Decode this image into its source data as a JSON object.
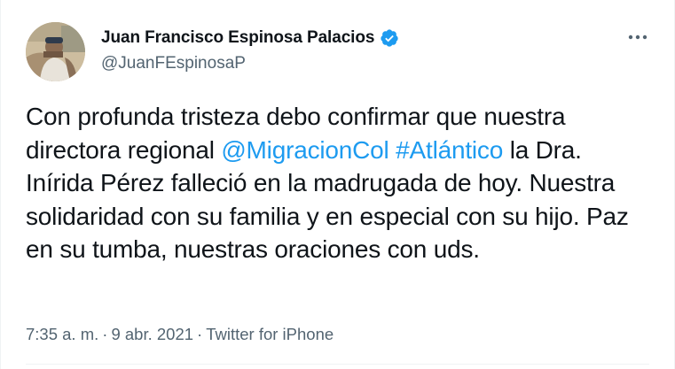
{
  "tweet": {
    "author": {
      "display_name": "Juan Francisco Espinosa Palacios",
      "handle": "@JuanFEspinosaP",
      "verified": true,
      "avatar_icon": "profile-photo"
    },
    "text": {
      "part1": "Con profunda tristeza debo confirmar que nuestra directora regional ",
      "mention": "@MigracionCol",
      "space": " ",
      "hashtag": "#Atlántico",
      "part2": " la Dra. Inírida Pérez falleció en la madrugada de hoy. Nuestra solidaridad con su familia y en especial con su hijo. Paz en su tumba, nuestras oraciones con uds."
    },
    "meta": {
      "time": "7:35 a. m.",
      "separator": "·",
      "date": "9 abr. 2021",
      "source": "Twitter for iPhone"
    }
  },
  "colors": {
    "link": "#1d9bf0",
    "secondary_text": "#536471",
    "primary_text": "#0f1419",
    "verified_badge": "#1d9bf0",
    "divider": "#eff3f4"
  },
  "icons": {
    "verified": "verified-badge-icon",
    "more": "more-options-icon"
  }
}
